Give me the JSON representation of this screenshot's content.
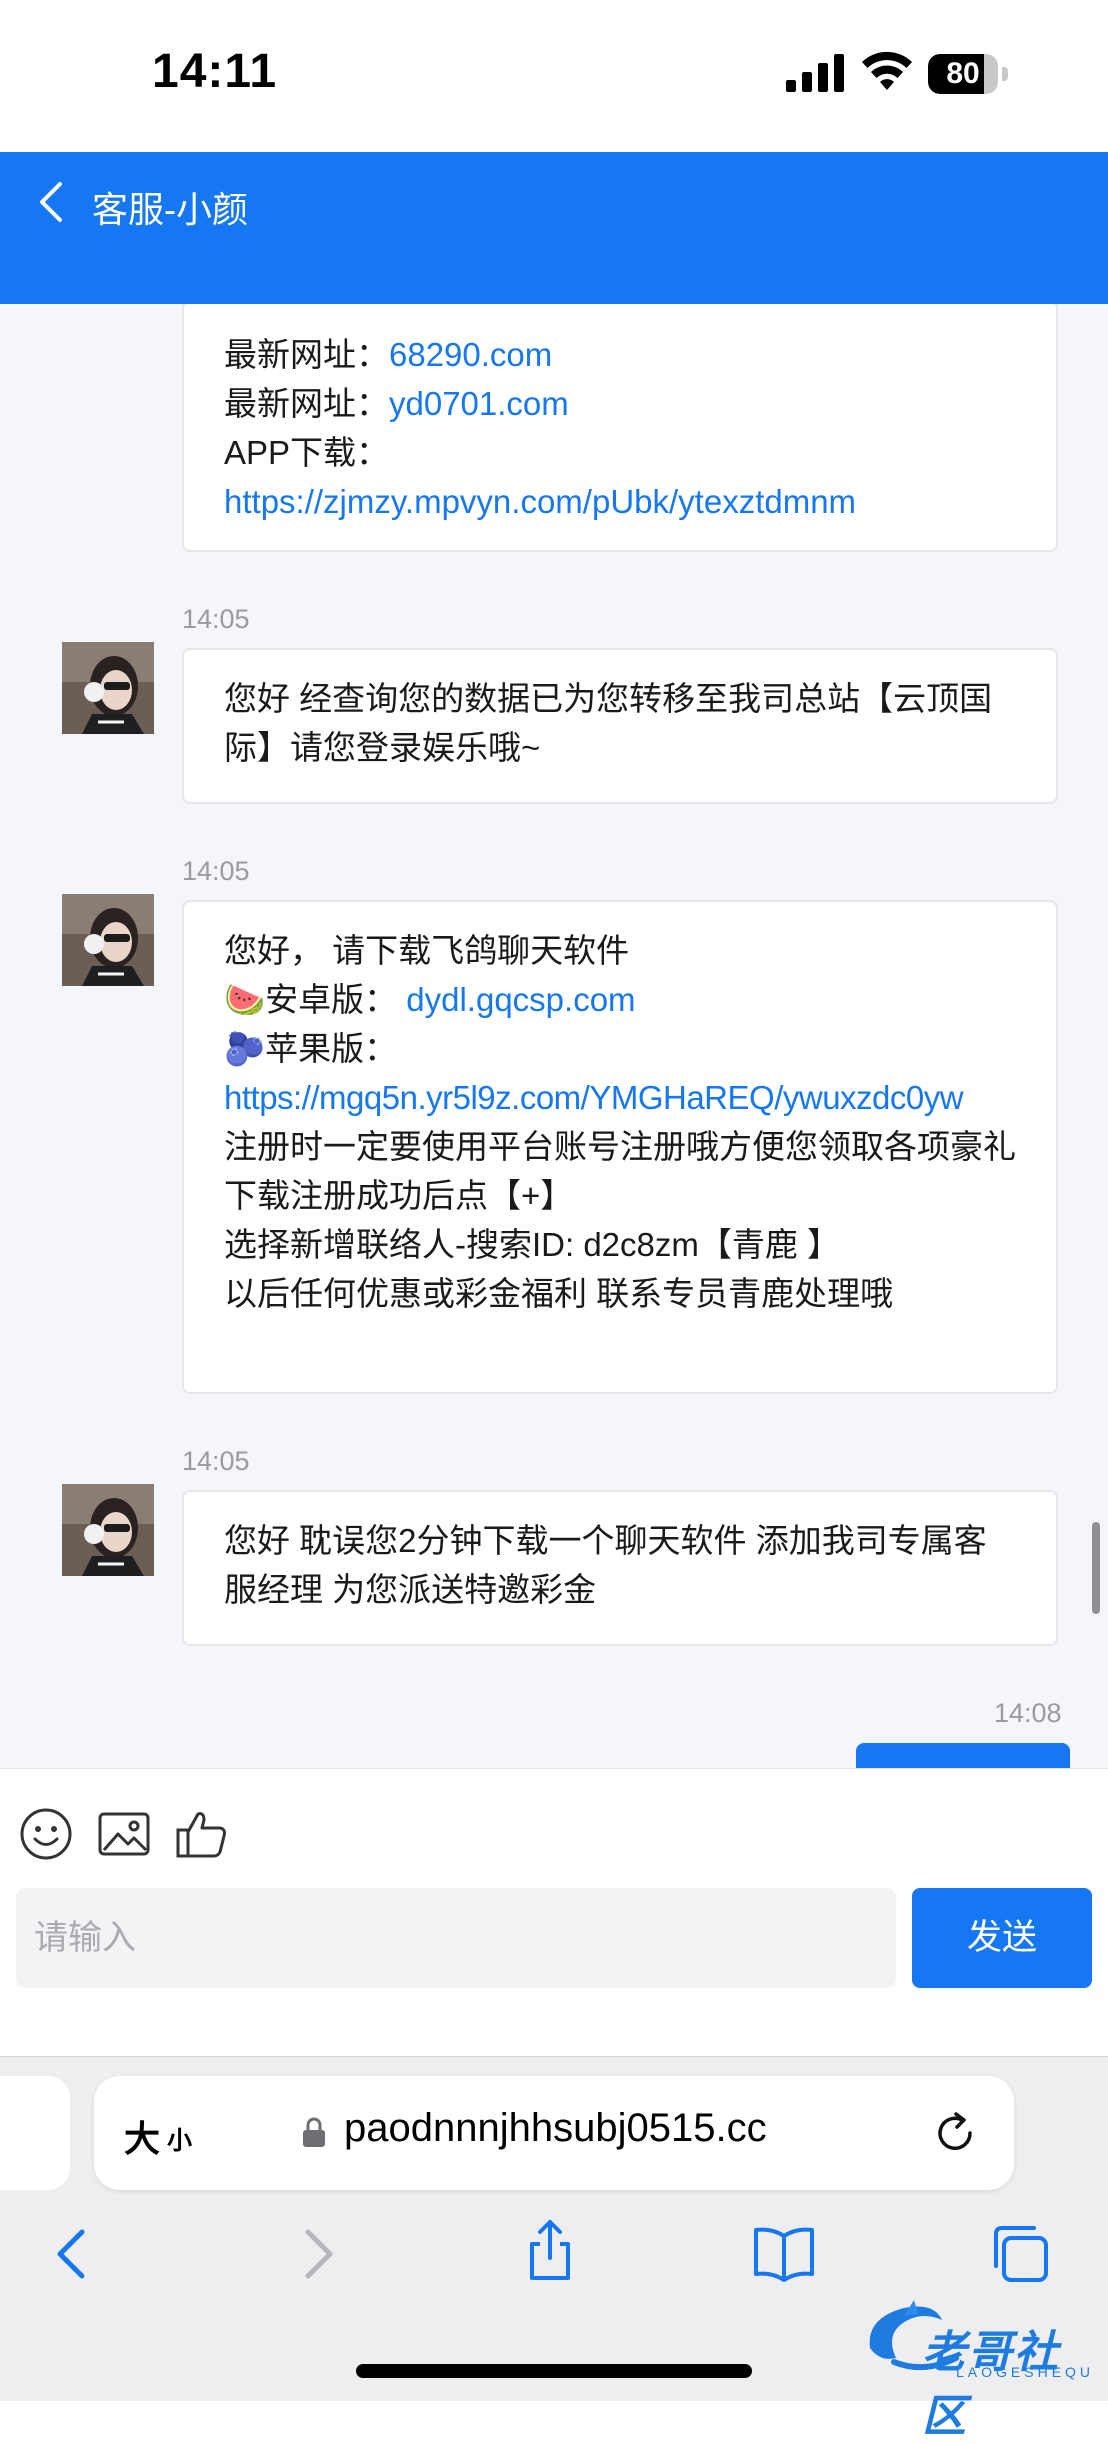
{
  "status_bar": {
    "time": "14:11",
    "battery_level": "80",
    "battery_fraction": 0.8
  },
  "header": {
    "back_icon": "chevron-left-icon",
    "title": "客服-小颜"
  },
  "messages": [
    {
      "lines": [
        {
          "prefix": "最新网址：",
          "link": "68290.com"
        },
        {
          "prefix": "最新网址：",
          "link": "yd0701.com"
        },
        {
          "prefix": "APP下载：",
          "link": ""
        },
        {
          "prefix": "",
          "link": "https://zjmzy.mpvyn.com/pUbk/ytexztdmnm"
        }
      ]
    },
    {
      "time": "14:05",
      "text": "您好 经查询您的数据已为您转移至我司总站【云顶国际】请您登录娱乐哦~"
    },
    {
      "time": "14:05",
      "greeting": "您好， 请下载飞鸽聊天软件",
      "android_emoji": "🍉",
      "android_label": "安卓版：",
      "android_link": "dydl.gqcsp.com",
      "ios_emoji": "🫐",
      "ios_label": "苹果版：",
      "ios_link": "https://mgq5n.yr5l9z.com/YMGHaREQ/ywuxzdc0yw",
      "register_note": "注册时一定要使用平台账号注册哦方便您领取各项豪礼",
      "after_download": "下载注册成功后点【+】",
      "add_contact": "选择新增联络人-搜索ID: d2c8zm【青鹿 】",
      "contact_note": "以后任何优惠或彩金福利 联系专员青鹿处理哦"
    },
    {
      "time": "14:05",
      "text": "您好 耽误您2分钟下载一个聊天软件 添加我司专属客服经理 为您派送特邀彩金"
    },
    {
      "time": "14:08"
    }
  ],
  "composer": {
    "emoji_icon": "smiley-icon",
    "image_icon": "image-icon",
    "like_icon": "thumbs-up-icon",
    "placeholder": "请输入",
    "send_label": "发送"
  },
  "browser": {
    "text_size_big": "大",
    "text_size_small": "小",
    "url": "paodnnnjhhsubj0515.cc",
    "nav_icons": [
      "back-icon",
      "forward-icon",
      "share-icon",
      "bookmarks-icon",
      "tabs-icon"
    ]
  },
  "watermark": {
    "text": "老哥社区",
    "subtext": "LAOGESHEQU"
  },
  "colors": {
    "brand": "#1677f2",
    "chat_background": "#f5f6fa",
    "bubble_border": "#e4e6ea",
    "timestamp": "#9a9a9f"
  }
}
